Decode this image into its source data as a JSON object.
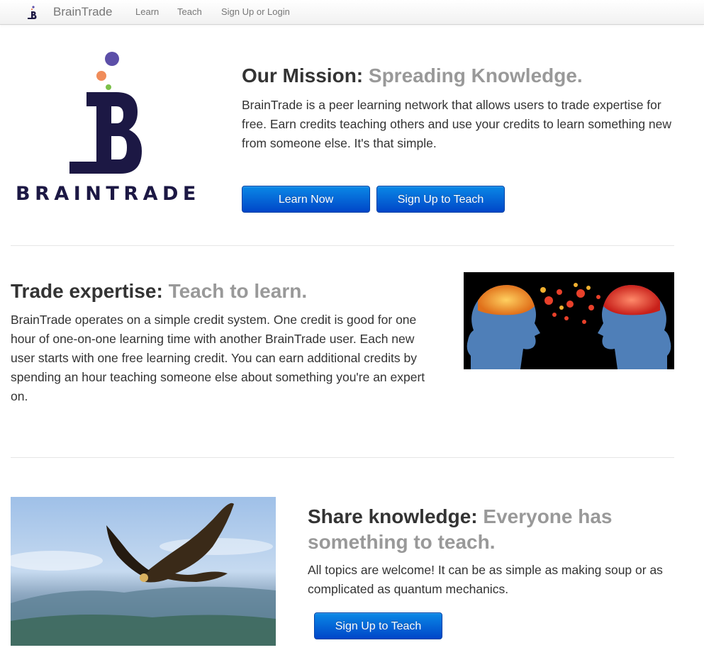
{
  "navbar": {
    "brand": "BrainTrade",
    "links": [
      {
        "label": "Learn"
      },
      {
        "label": "Teach"
      },
      {
        "label": "Sign Up or Login"
      }
    ]
  },
  "logo": {
    "wordmark": "BRAINTRADE"
  },
  "mission": {
    "heading": "Our Mission:",
    "heading_muted": "Spreading Knowledge.",
    "body": "BrainTrade is a peer learning network that allows users to trade expertise for free. Earn credits teaching others and use your credits to learn something new from someone else. It's that simple.",
    "learn_button": "Learn Now",
    "teach_button": "Sign Up to Teach"
  },
  "trade": {
    "heading": "Trade expertise:",
    "heading_muted": "Teach to learn.",
    "body": "BrainTrade operates on a simple credit system. One credit is good for one hour of one-on-one learning time with another BrainTrade user. Each new user starts with one free learning credit. You can earn additional credits by spending an hour teaching someone else about something you're an expert on."
  },
  "share": {
    "heading": "Share knowledge:",
    "heading_muted": "Everyone has something to teach.",
    "body": "All topics are welcome! It can be as simple as making soup or as complicated as quantum mechanics.",
    "teach_button": "Sign Up to Teach"
  },
  "colors": {
    "button": "#0a6fdc",
    "logo_navy": "#1c1844",
    "dot_purple": "#5c4fa8",
    "dot_orange": "#f08c5a",
    "dot_green": "#7cc04a"
  }
}
